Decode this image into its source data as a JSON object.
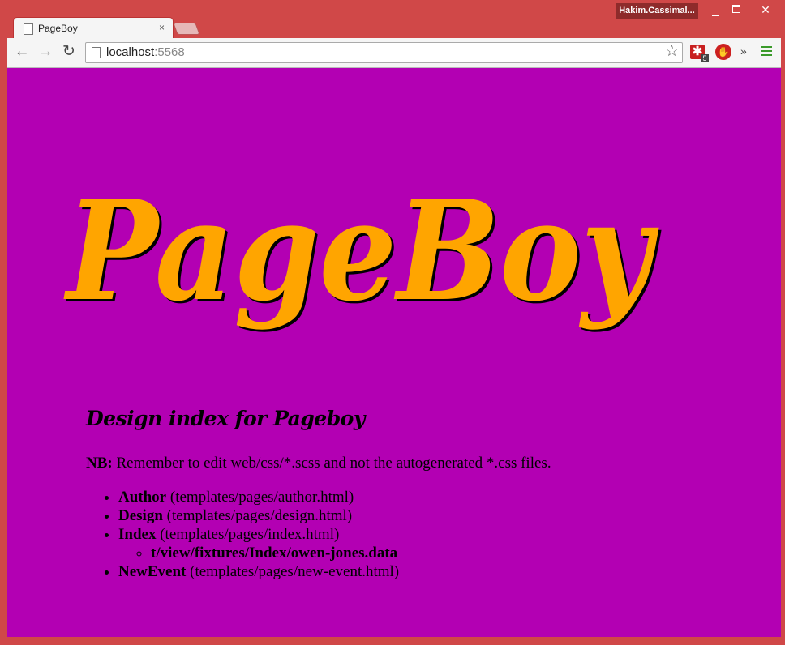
{
  "window": {
    "user": "Hakim.Cassimal...",
    "tab_title": "PageBoy",
    "tab_close": "×",
    "minimize_icon": "minimize-icon",
    "maximize_icon": "maximize-icon",
    "close_glyph": "✕"
  },
  "toolbar": {
    "url_host": "localhost",
    "url_port": ":5568",
    "back_glyph": "←",
    "forward_glyph": "→",
    "reload_glyph": "↻",
    "star_glyph": "☆",
    "ext1_glyph": "✱",
    "ext1_badge": "5",
    "ext2_glyph": "✋",
    "overflow_glyph": "»"
  },
  "page": {
    "logo_text": "PageBoy",
    "heading": "Design index for Pageboy",
    "note_label": "NB:",
    "note_text": " Remember to edit web/css/*.scss and not the autogenerated *.css files.",
    "items": [
      {
        "name": "Author",
        "path": " (templates/pages/author.html)"
      },
      {
        "name": "Design",
        "path": " (templates/pages/design.html)"
      },
      {
        "name": "Index",
        "path": " (templates/pages/index.html)",
        "fixture": "t/view/fixtures/Index/owen-jones.data"
      },
      {
        "name": "NewEvent",
        "path": " (templates/pages/new-event.html)"
      }
    ]
  },
  "colors": {
    "page_background": "#b300b3",
    "logo_fill": "#ffa500",
    "frame": "#d04848"
  }
}
